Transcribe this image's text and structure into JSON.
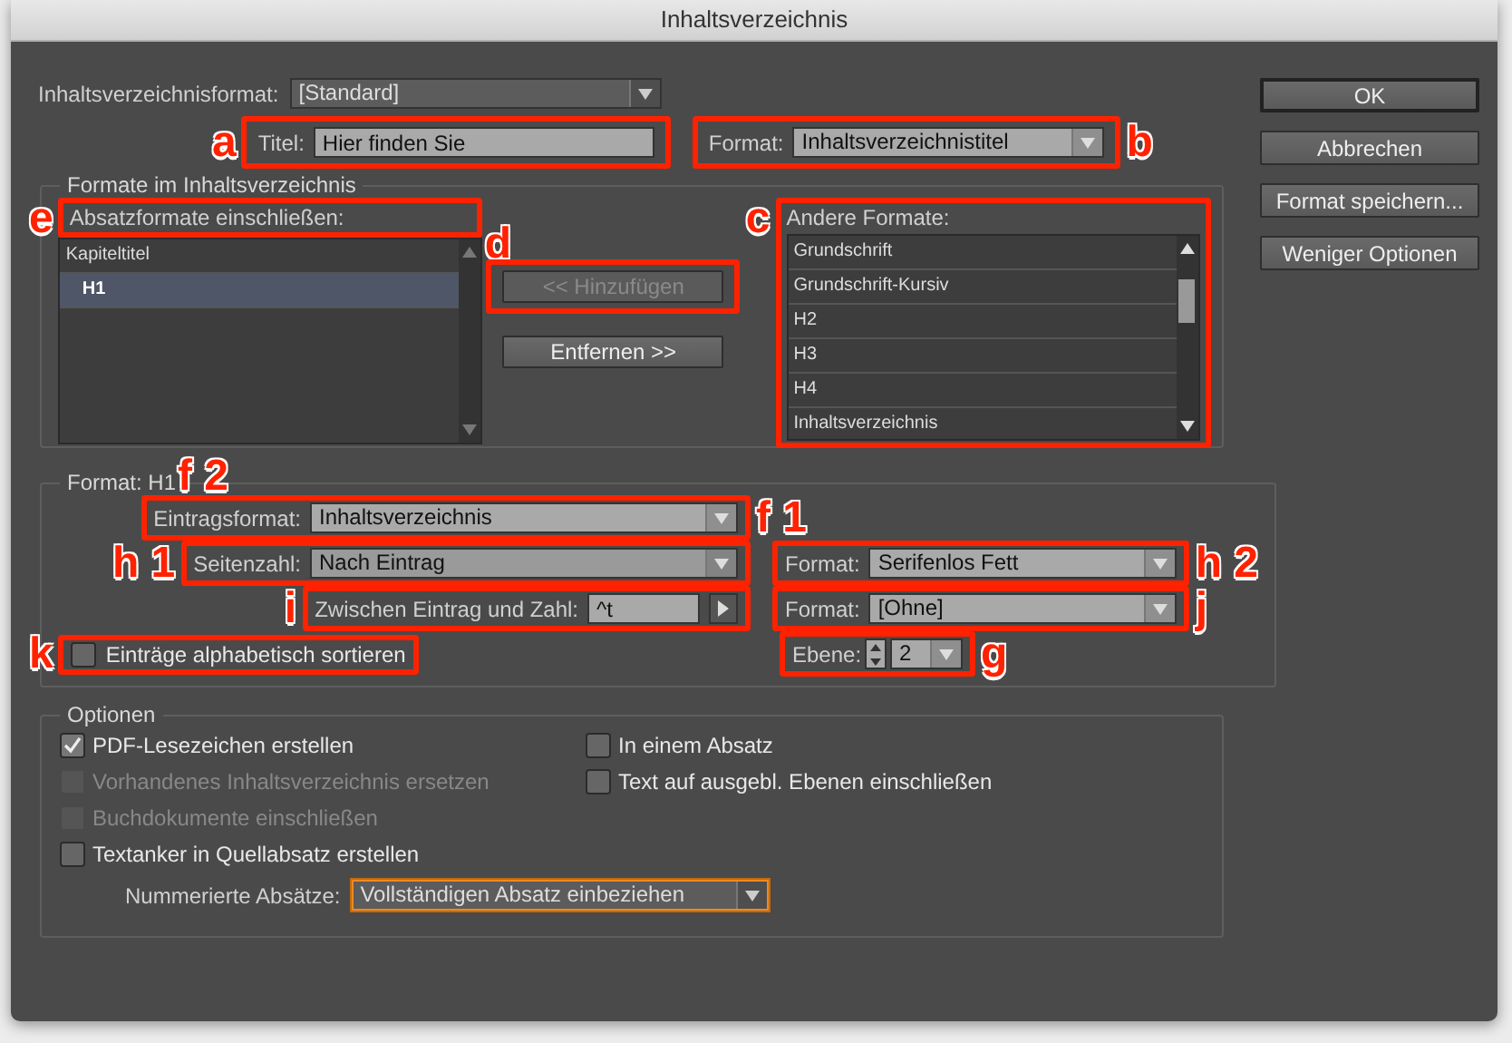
{
  "window": {
    "title": "Inhaltsverzeichnis"
  },
  "toc_format": {
    "label": "Inhaltsverzeichnisformat:",
    "value": "[Standard]"
  },
  "title_field": {
    "markers": [
      {
        "text": "a",
        "kind": "left"
      }
    ],
    "label": "Titel:",
    "value": "Hier finden Sie"
  },
  "title_format": {
    "markers": [
      {
        "text": "b",
        "kind": "right"
      }
    ],
    "label": "Format:",
    "value": "Inhaltsverzeichnistitel"
  },
  "formats_group": {
    "title": "Formate im Inhaltsverzeichnis",
    "included": {
      "markers": [
        {
          "text": "e",
          "kind": "left"
        }
      ],
      "label": "Absatzformate einschließen:",
      "items": [
        {
          "text": "Kapiteltitel",
          "selected": false,
          "children": [
            {
              "text": "H1",
              "selected": true
            }
          ]
        }
      ]
    },
    "add_button": {
      "markers": [
        {
          "text": "d",
          "kind": "top"
        }
      ],
      "label": "<< Hinzufügen",
      "disabled": true
    },
    "remove_button": {
      "label": "Entfernen >>",
      "disabled": false
    },
    "other": {
      "markers": [
        {
          "text": "c",
          "kind": "left"
        }
      ],
      "label": "Andere Formate:",
      "items": [
        {
          "text": "Grundschrift",
          "selected": false
        },
        {
          "text": "Grundschrift-Kursiv",
          "selected": false
        },
        {
          "text": "H2",
          "selected": false
        },
        {
          "text": "H3",
          "selected": false
        },
        {
          "text": "H4",
          "selected": false
        },
        {
          "text": "Inhaltsverzeichnis",
          "selected": false
        }
      ]
    }
  },
  "entry_group": {
    "title": "Format: H1",
    "entry_format": {
      "markers": [
        {
          "text": "f 2",
          "kind": "top"
        },
        {
          "text": "f 1",
          "kind": "right"
        }
      ],
      "label": "Eintragsformat:",
      "value": "Inhaltsverzeichnis"
    },
    "page_number": {
      "markers": [
        {
          "text": "h 1",
          "kind": "left"
        }
      ],
      "label": "Seitenzahl:",
      "value": "Nach Eintrag"
    },
    "page_number_format": {
      "markers": [
        {
          "text": "h 2",
          "kind": "right"
        }
      ],
      "label": "Format:",
      "value": "Serifenlos Fett"
    },
    "between": {
      "markers": [
        {
          "text": "i",
          "kind": "left"
        }
      ],
      "label": "Zwischen Eintrag und Zahl:",
      "value": "^t"
    },
    "between_format": {
      "markers": [
        {
          "text": "j",
          "kind": "right"
        }
      ],
      "label": "Format:",
      "value": "[Ohne]"
    },
    "sort": {
      "markers": [
        {
          "text": "k",
          "kind": "left"
        }
      ],
      "label": "Einträge alphabetisch sortieren",
      "checked": false
    },
    "level": {
      "markers": [
        {
          "text": "g",
          "kind": "right"
        }
      ],
      "label": "Ebene:",
      "value": "2"
    }
  },
  "options_group": {
    "title": "Optionen",
    "left": [
      {
        "label": "PDF-Lesezeichen erstellen",
        "checked": true,
        "disabled": false
      },
      {
        "label": "Vorhandenes Inhaltsverzeichnis ersetzen",
        "checked": false,
        "disabled": true
      },
      {
        "label": "Buchdokumente einschließen",
        "checked": false,
        "disabled": true
      },
      {
        "label": "Textanker in Quellabsatz erstellen",
        "checked": false,
        "disabled": false
      }
    ],
    "right": [
      {
        "label": "In einem Absatz",
        "checked": false,
        "disabled": false
      },
      {
        "label": "Text auf ausgebl. Ebenen einschließen",
        "checked": false,
        "disabled": false
      }
    ],
    "numbered": {
      "label": "Nummerierte Absätze:",
      "value": "Vollständigen Absatz einbeziehen",
      "focused": true
    }
  },
  "buttons": [
    {
      "label": "OK",
      "default": true
    },
    {
      "label": "Abbrechen",
      "default": false
    },
    {
      "label": "Format speichern...",
      "default": false
    },
    {
      "label": "Weniger Optionen",
      "default": false
    }
  ]
}
